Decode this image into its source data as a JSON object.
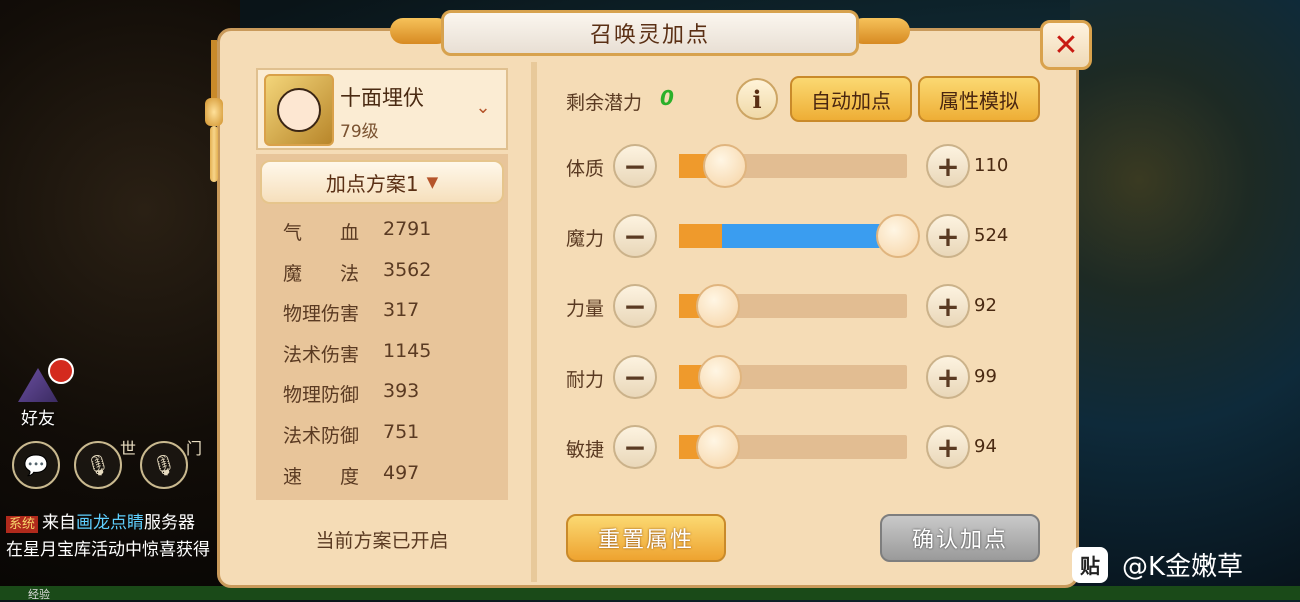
{
  "title": "召唤灵加点",
  "pet": {
    "name": "十面埋伏",
    "level": "79级"
  },
  "scheme": {
    "label": "加点方案1",
    "status": "当前方案已开启"
  },
  "stats": [
    {
      "name": "气　　血",
      "value": "2791"
    },
    {
      "name": "魔　　法",
      "value": "3562"
    },
    {
      "name": "物理伤害",
      "value": "317"
    },
    {
      "name": "法术伤害",
      "value": "1145"
    },
    {
      "name": "物理防御",
      "value": "393"
    },
    {
      "name": "法术防御",
      "value": "751"
    },
    {
      "name": "速　　度",
      "value": "497"
    }
  ],
  "potential": {
    "label": "剩余潜力",
    "value": "0"
  },
  "buttons": {
    "info": "i",
    "auto": "自动加点",
    "simulate": "属性模拟",
    "reset": "重置属性",
    "confirm": "确认加点",
    "close": "✕"
  },
  "attributes": [
    {
      "name": "体质",
      "value": "110",
      "base_fraction": 0.2,
      "added_fraction": 0.0
    },
    {
      "name": "魔力",
      "value": "524",
      "base_fraction": 0.19,
      "added_fraction": 0.77
    },
    {
      "name": "力量",
      "value": "92",
      "base_fraction": 0.17,
      "added_fraction": 0.0
    },
    {
      "name": "耐力",
      "value": "99",
      "base_fraction": 0.18,
      "added_fraction": 0.0
    },
    {
      "name": "敏捷",
      "value": "94",
      "base_fraction": 0.17,
      "added_fraction": 0.0
    }
  ],
  "chat": {
    "friend_label": "好友",
    "world_tag": "世",
    "sect_tag": "门",
    "system_tag": "系统",
    "line1_prefix": "来自",
    "line1_highlight": "画龙点睛",
    "line1_suffix": "服务器",
    "line2": "在星月宝库活动中惊喜获得"
  },
  "exp_label": "经验",
  "watermark": {
    "logo": "贴",
    "text": "@K金嫩草"
  },
  "colors": {
    "base_fill": "#ef9a2c",
    "added_fill": "#3a9df0",
    "potential": "#2bb02a",
    "close_x": "#c81a12"
  }
}
